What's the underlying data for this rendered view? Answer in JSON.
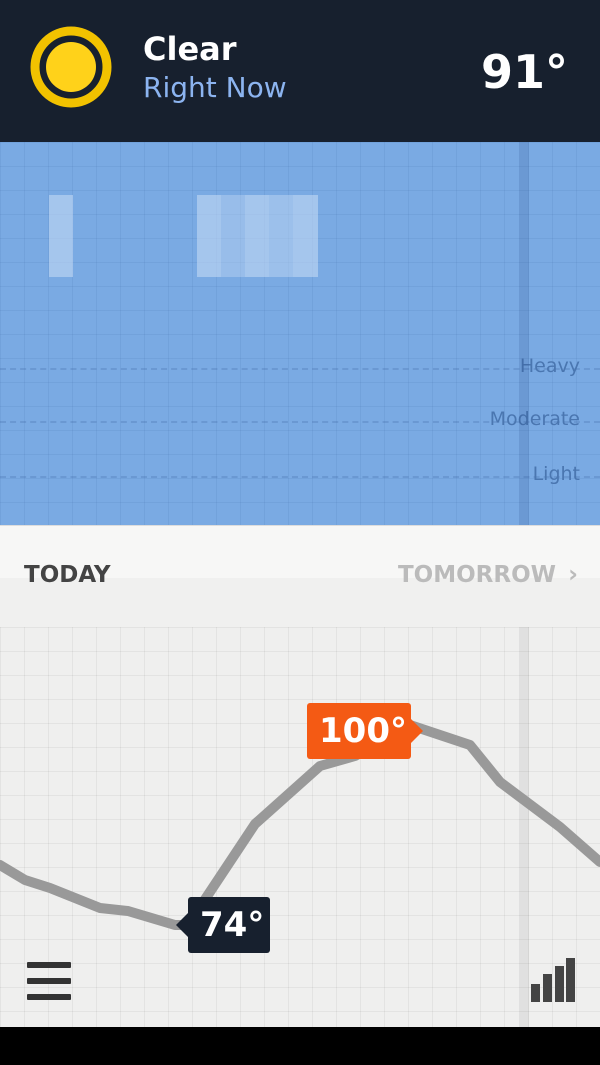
{
  "header": {
    "condition": "Clear",
    "subtitle": "Right Now",
    "temperature": "91°",
    "icon": "sun-icon",
    "icon_color": "#ffd21a"
  },
  "precip": {
    "intensity_labels": [
      "Heavy",
      "Moderate",
      "Light"
    ]
  },
  "day_nav": {
    "today_label": "TODAY",
    "tomorrow_label": "TOMORROW",
    "chevron": "›"
  },
  "temp_graph": {
    "high_label": "100°",
    "low_label": "74°",
    "high_color": "#f45a14",
    "low_color": "#17202e",
    "line_color": "#999999"
  },
  "bottom": {
    "menu_icon": "menu-icon",
    "stats_icon": "bar-chart-icon"
  }
}
